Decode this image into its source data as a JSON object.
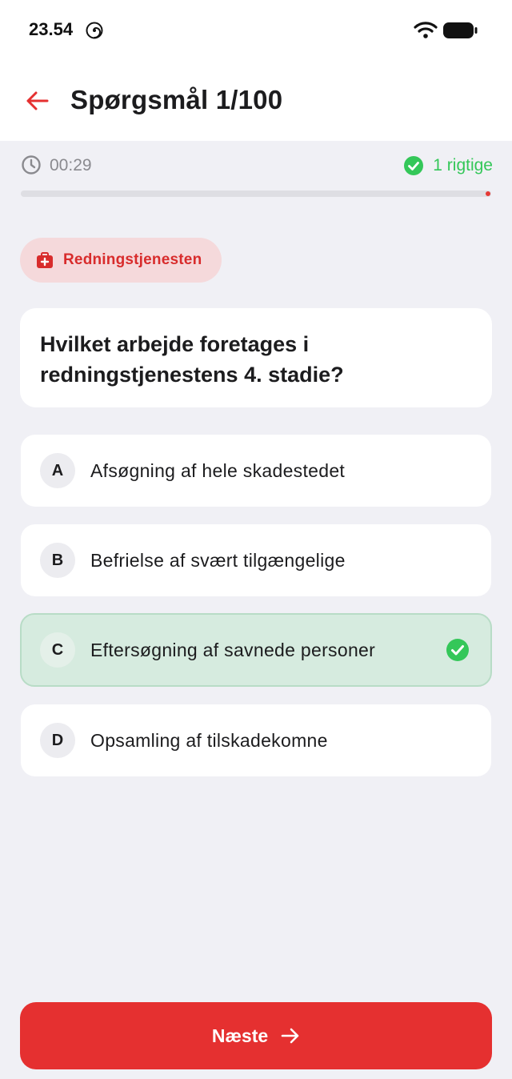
{
  "status_bar": {
    "time": "23.54",
    "icons": [
      "spiral-icon",
      "wifi-icon",
      "battery-icon"
    ]
  },
  "header": {
    "back_icon": "arrow-left-icon",
    "title": "Spørgsmål 1/100"
  },
  "quiz": {
    "timer_icon": "clock-icon",
    "timer": "00:29",
    "correct_icon": "check-circle-icon",
    "correct_count": "1 rigtige",
    "progress": 0.01
  },
  "category": {
    "icon": "first-aid-kit-icon",
    "label": "Redningstjenesten"
  },
  "question": {
    "text": "Hvilket arbejde foretages i redningstjenestens 4. stadie?"
  },
  "answers": [
    {
      "letter": "A",
      "text": "Afsøgning af hele skadestedet",
      "state": "default"
    },
    {
      "letter": "B",
      "text": "Befrielse af svært tilgængelige",
      "state": "default"
    },
    {
      "letter": "C",
      "text": "Eftersøgning af savnede personer",
      "state": "correct"
    },
    {
      "letter": "D",
      "text": "Opsamling af tilskadekomne",
      "state": "default"
    }
  ],
  "next_button": {
    "label": "Næste",
    "icon": "arrow-right-icon"
  },
  "colors": {
    "accent": "#e53030",
    "success": "#34c759",
    "chip_bg": "#f5d9db",
    "correct_bg": "#d6ebdf",
    "page_bg": "#f0f0f5"
  }
}
